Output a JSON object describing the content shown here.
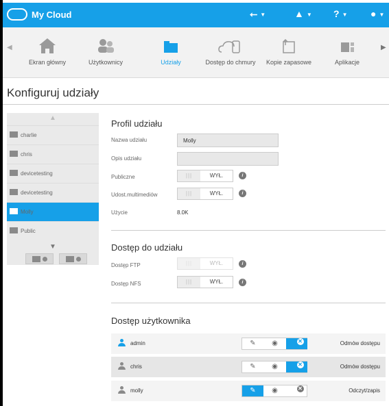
{
  "topbar": {
    "app_title": "My Cloud",
    "usb_icon": "usb-icon",
    "bell_icon": "bell-icon",
    "help_icon": "help-icon",
    "user_icon": "user-icon",
    "brand_color": "#16a0e8"
  },
  "nav": {
    "items": [
      {
        "label": "Ekran główny",
        "icon": "home-icon"
      },
      {
        "label": "Użytkownicy",
        "icon": "users-icon"
      },
      {
        "label": "Udziały",
        "icon": "shares-icon"
      },
      {
        "label": "Dostęp do chmury",
        "icon": "cloud-device-icon"
      },
      {
        "label": "Kopie zapasowe",
        "icon": "backup-icon"
      },
      {
        "label": "Aplikacje",
        "icon": "apps-icon"
      }
    ],
    "active_index": 2
  },
  "page_title": "Konfiguruj udziały",
  "sidebar": {
    "shares": [
      "charlie",
      "chris",
      "devicetesting",
      "devicetesting",
      "Molly",
      "Public"
    ],
    "selected": "Molly"
  },
  "profile": {
    "title": "Profil udziału",
    "name_label": "Nazwa udziału",
    "name_value": "Molly",
    "desc_label": "Opis udziału",
    "desc_value": "",
    "public_label": "Publiczne",
    "public_value": "WYŁ.",
    "media_label": "Udost.multimediów",
    "media_value": "WYŁ.",
    "usage_label": "Użycie",
    "usage_value": "8.0K",
    "toggle_bars": "|||"
  },
  "access": {
    "title": "Dostęp do udziału",
    "ftp_label": "Dostęp FTP",
    "ftp_value": "WYŁ.",
    "nfs_label": "Dostęp NFS",
    "nfs_value": "WYŁ."
  },
  "user_access": {
    "title": "Dostęp użytkownika",
    "users": [
      {
        "name": "admin",
        "permission": "Odmów dostępu",
        "selected": "deny"
      },
      {
        "name": "chris",
        "permission": "Odmów dostępu",
        "selected": "deny"
      },
      {
        "name": "molly",
        "permission": "Odczyt/zapis",
        "selected": "readwrite"
      }
    ]
  }
}
